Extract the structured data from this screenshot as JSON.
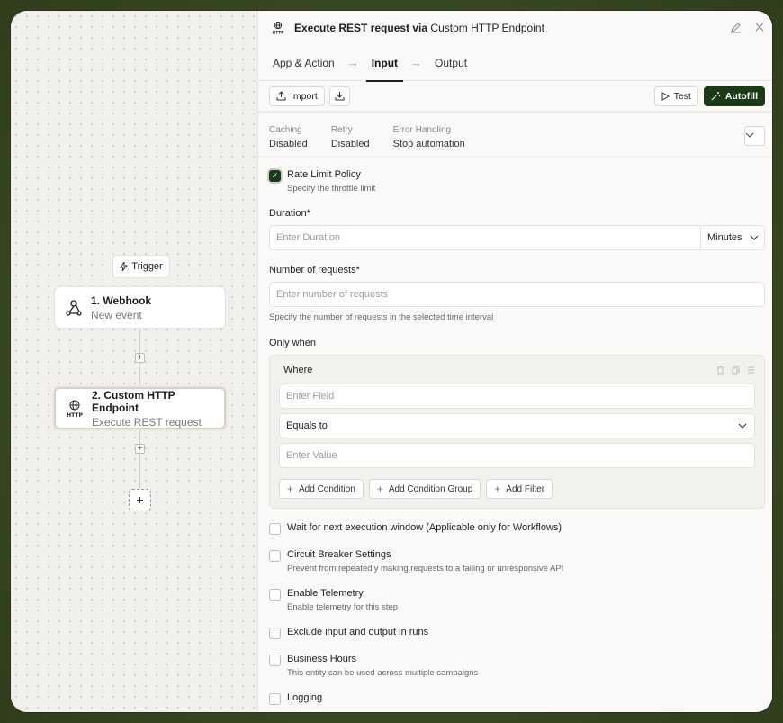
{
  "canvas": {
    "trigger_label": "Trigger",
    "nodes": [
      {
        "title": "1. Webhook",
        "subtitle": "New event"
      },
      {
        "title": "2. Custom HTTP Endpoint",
        "subtitle": "Execute REST request"
      }
    ]
  },
  "panel": {
    "title": "Execute REST request via",
    "title_suffix": "Custom HTTP Endpoint",
    "tabs": [
      "App & Action",
      "Input",
      "Output"
    ],
    "active_tab": "Input",
    "toolbar": {
      "import": "Import",
      "test": "Test",
      "autofill": "Autofill"
    },
    "settings": [
      {
        "label": "Caching",
        "value": "Disabled"
      },
      {
        "label": "Retry",
        "value": "Disabled"
      },
      {
        "label": "Error Handling",
        "value": "Stop automation"
      }
    ],
    "rate_limit": {
      "label": "Rate Limit Policy",
      "help": "Specify the throttle limit",
      "checked": true
    },
    "duration": {
      "label": "Duration*",
      "placeholder": "Enter Duration",
      "unit": "Minutes"
    },
    "requests": {
      "label": "Number of requests*",
      "placeholder": "Enter number of requests",
      "help": "Specify the number of requests in the selected time interval"
    },
    "only_when": {
      "label": "Only when",
      "where": "Where",
      "field_placeholder": "Enter Field",
      "operator": "Equals to",
      "value_placeholder": "Enter Value",
      "buttons": [
        "Add Condition",
        "Add Condition Group",
        "Add Filter"
      ]
    },
    "options": [
      {
        "label": "Wait for next execution window (Applicable only for Workflows)",
        "help": ""
      },
      {
        "label": "Circuit Breaker Settings",
        "help": "Prevent from repeatedly making requests to a failing or unresponsive API"
      },
      {
        "label": "Enable Telemetry",
        "help": "Enable telemetry for this step"
      },
      {
        "label": "Exclude input and output in runs",
        "help": ""
      },
      {
        "label": "Business Hours",
        "help": "This entity can be used across multiple campaigns"
      },
      {
        "label": "Logging",
        "help": ""
      }
    ]
  },
  "colors": {
    "accent": "#1c3a18",
    "background": "#3a4a22"
  }
}
